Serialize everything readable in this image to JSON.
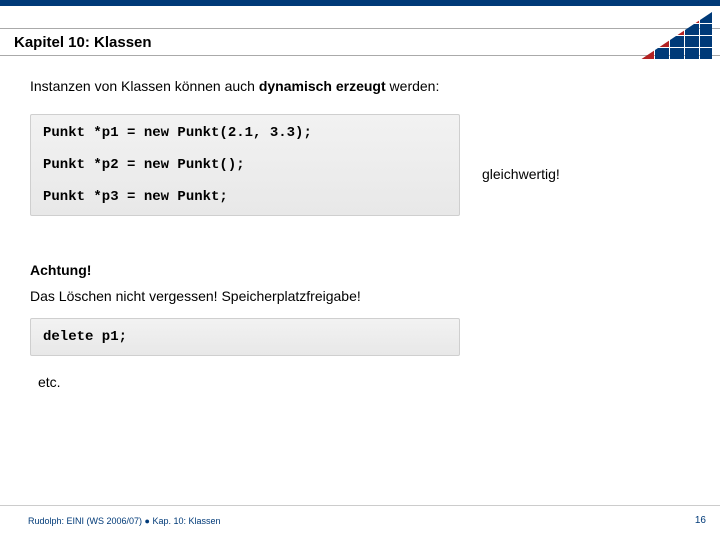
{
  "header": {
    "chapter_title": "Kapitel 10: Klassen"
  },
  "content": {
    "intro_prefix": "Instanzen von Klassen können auch ",
    "intro_bold": "dynamisch erzeugt",
    "intro_suffix": " werden:",
    "code1": "Punkt *p1 = new Punkt(2.1, 3.3);\n\nPunkt *p2 = new Punkt();\n\nPunkt *p3 = new Punkt;",
    "side_label": "gleichwertig!",
    "warn_head": "Achtung!",
    "warn_text": "Das Löschen nicht vergessen! Speicherplatzfreigabe!",
    "code2": "delete p1;",
    "etc": "etc."
  },
  "footer": {
    "text": "Rudolph: EINI (WS 2006/07)  ●  Kap. 10: Klassen",
    "page": "16"
  }
}
